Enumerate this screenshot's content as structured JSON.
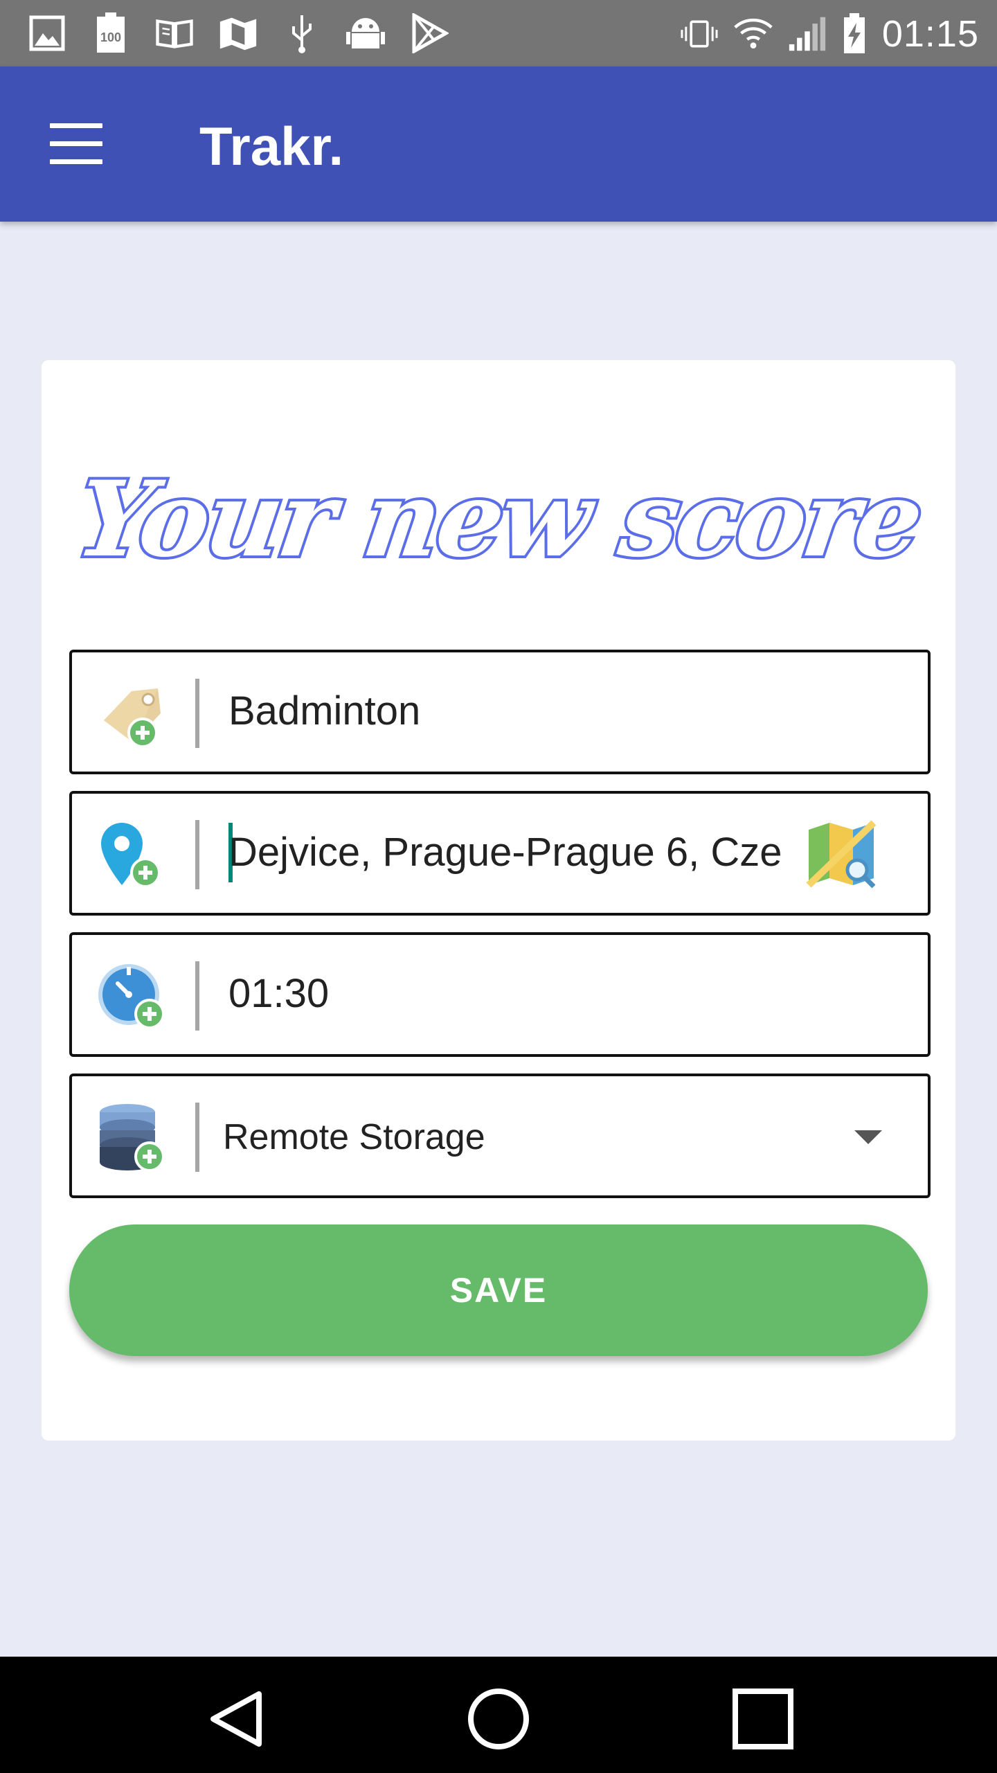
{
  "status_bar": {
    "time": "01:15",
    "left_icons": [
      "image-icon",
      "battery-100-icon",
      "book-icon",
      "maps-icon",
      "usb-icon",
      "android-icon",
      "play-store-icon"
    ],
    "right_icons": [
      "vibrate-icon",
      "wifi-icon",
      "signal-icon",
      "battery-charging-icon"
    ]
  },
  "app_bar": {
    "title": "Trakr.",
    "menu_icon": "hamburger-menu-icon"
  },
  "form": {
    "headline": "Your new score",
    "activity": {
      "value": "Badminton",
      "icon": "tag-add-icon"
    },
    "location": {
      "value": "Dejvice, Prague-Prague 6, Cze",
      "icon": "location-add-icon",
      "action_icon": "map-search-icon"
    },
    "duration": {
      "value": "01:30",
      "icon": "clock-add-icon"
    },
    "storage": {
      "value": "Remote Storage",
      "icon": "database-add-icon"
    },
    "save_label": "SAVE"
  },
  "colors": {
    "app_bar": "#3f51b5",
    "background": "#e8eaf6",
    "save_button": "#66bb6a",
    "headline": "#5b6ee8"
  },
  "nav_bar": {
    "icons": [
      "back-icon",
      "home-icon",
      "recents-icon"
    ]
  }
}
